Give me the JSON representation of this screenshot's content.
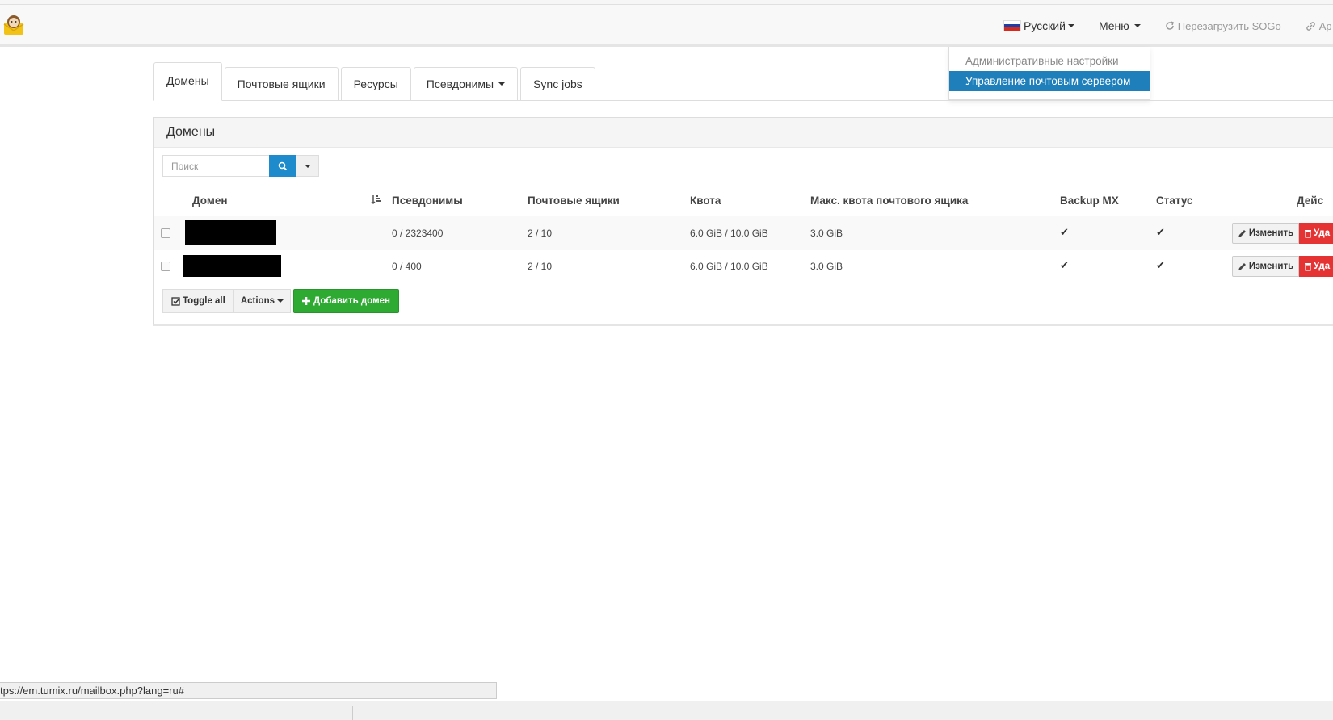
{
  "nav": {
    "language": "Русский",
    "menu": "Меню",
    "reload_sogo": "Перезагрузить SOGo",
    "apps": "Ap"
  },
  "dropdown": {
    "items": [
      "Административные настройки",
      "Управление почтовым сервером"
    ]
  },
  "tabs": [
    "Домены",
    "Почтовые ящики",
    "Ресурсы",
    "Псевдонимы",
    "Sync jobs"
  ],
  "panel": {
    "title": "Домены",
    "search_placeholder": "Поиск"
  },
  "table": {
    "headers": [
      "Домен",
      "Псевдонимы",
      "Почтовые ящики",
      "Квота",
      "Макс. квота почтового ящика",
      "Backup MX",
      "Статус",
      "Дейс"
    ],
    "rows": [
      {
        "aliases": "0 / 2323400",
        "mailboxes": "2 / 10",
        "quota": "6.0 GiB / 10.0 GiB",
        "max_quota": "3.0 GiB",
        "backup_mx": "✔",
        "status": "✔"
      },
      {
        "aliases": "0 / 400",
        "mailboxes": "2 / 10",
        "quota": "6.0 GiB / 10.0 GiB",
        "max_quota": "3.0 GiB",
        "backup_mx": "✔",
        "status": "✔"
      }
    ],
    "edit_label": "Изменить",
    "delete_label": "Уда"
  },
  "footer": {
    "toggle_all": "Toggle all",
    "actions": "Actions",
    "add_domain": "Добавить домен"
  },
  "statusbar": {
    "url": "tps://em.tumix.ru/mailbox.php?lang=ru#"
  },
  "colors": {
    "primary": "#1e8ccc",
    "success": "#2eaa33",
    "danger": "#e53333",
    "menu_active": "#1e7fbb"
  }
}
